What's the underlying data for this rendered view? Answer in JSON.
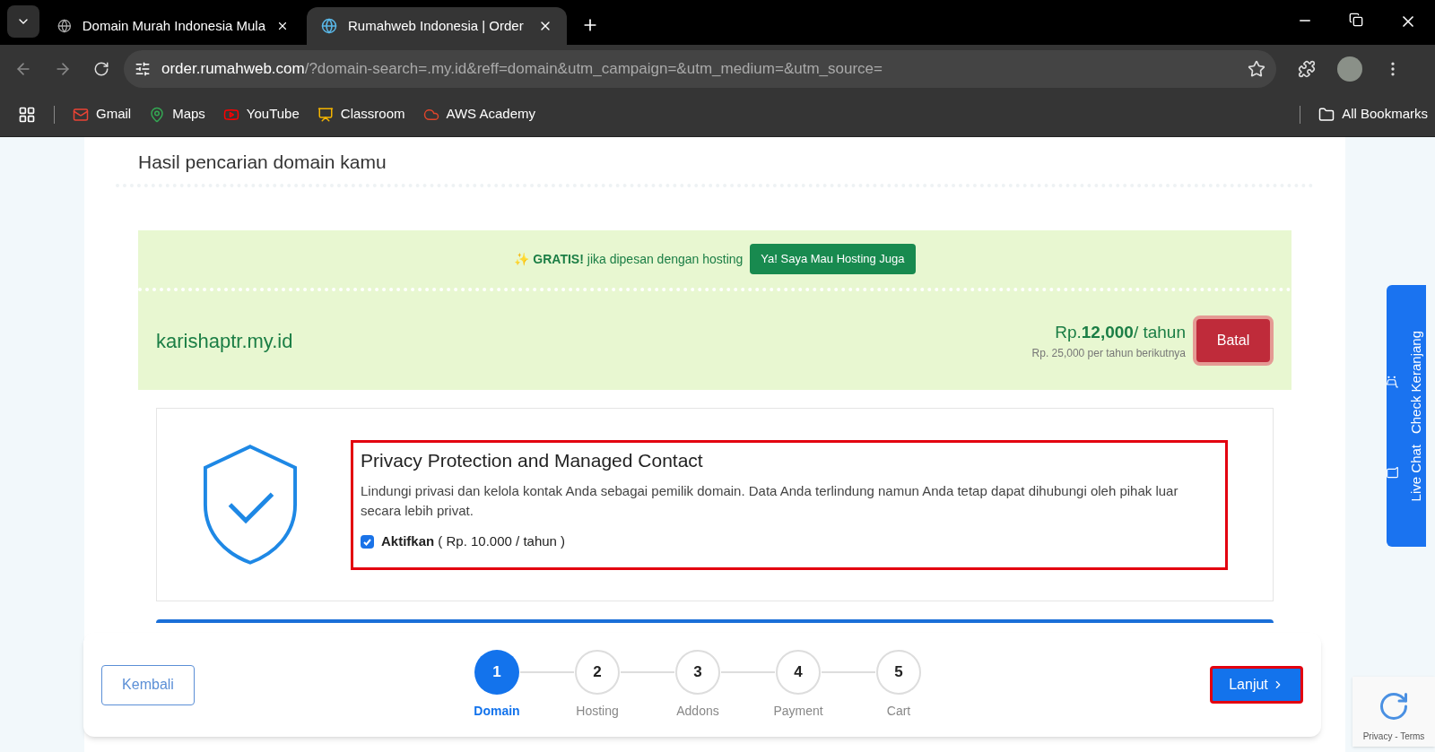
{
  "browser": {
    "tabs": [
      {
        "title": "Domain Murah Indonesia Mula",
        "selected": false
      },
      {
        "title": "Rumahweb Indonesia | Order",
        "selected": true
      }
    ],
    "url_host": "order.rumahweb.com",
    "url_rest": "/?domain-search=.my.id&reff=domain&utm_campaign=&utm_medium=&utm_source=",
    "bookmarks": [
      "Gmail",
      "Maps",
      "YouTube",
      "Classroom",
      "AWS Academy"
    ],
    "all_bookmarks": "All Bookmarks"
  },
  "heading": "Hasil pencarian domain kamu",
  "promo": {
    "icon": "✨",
    "bold": "GRATIS!",
    "text": "jika dipesan dengan hosting",
    "button": "Ya! Saya Mau Hosting Juga"
  },
  "domain": {
    "name": "karishaptr.my.id",
    "price_prefix": "Rp.",
    "price": "12,000",
    "price_suffix": "/ tahun",
    "renewal": "Rp. 25,000 per tahun berikutnya",
    "cancel": "Batal"
  },
  "privacy": {
    "title": "Privacy Protection and Managed Contact",
    "description": "Lindungi privasi dan kelola kontak Anda sebagai pemilik domain. Data Anda terlindung namun Anda tetap dapat dihubungi oleh pihak luar secara lebih privat.",
    "option": "Aktifkan",
    "option_price": "( Rp. 10.000 / tahun )",
    "checked": true
  },
  "side_tabs": [
    "Check Keranjang",
    "Live Chat"
  ],
  "stepper": {
    "back": "Kembali",
    "next": "Lanjut",
    "steps": [
      {
        "number": "1",
        "label": "Domain",
        "selected": true
      },
      {
        "number": "2",
        "label": "Hosting",
        "selected": false
      },
      {
        "number": "3",
        "label": "Addons",
        "selected": false
      },
      {
        "number": "4",
        "label": "Payment",
        "selected": false
      },
      {
        "number": "5",
        "label": "Cart",
        "selected": false
      }
    ]
  },
  "recaptcha": "Privacy - Terms"
}
